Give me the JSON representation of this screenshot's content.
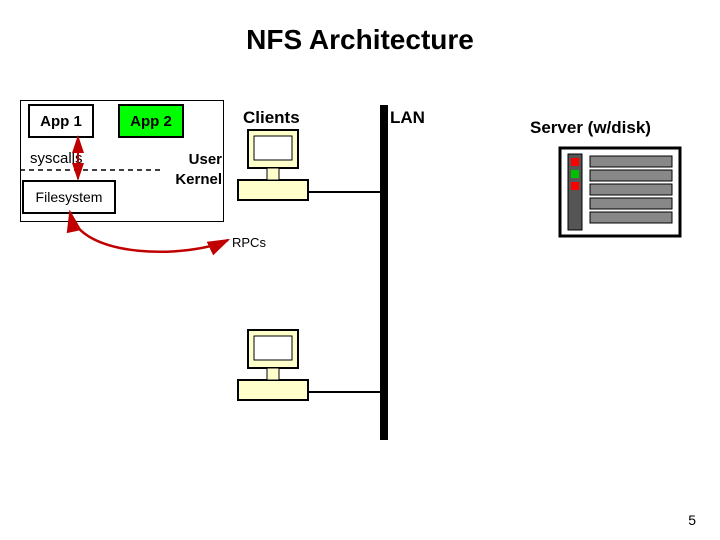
{
  "title": "NFS Architecture",
  "app1_label": "App 1",
  "app2_label": "App 2",
  "syscalls_label": "syscalls",
  "filesystem_label": "Filesystem",
  "user_label": "User",
  "kernel_label": "Kernel",
  "clients_label": "Clients",
  "lan_label": "LAN",
  "server_label": "Server (w/disk)",
  "rpcs_label": "RPCs",
  "page_number": "5",
  "colors": {
    "app2_fill": "#00ff00",
    "computer_fill": "#ffffcc",
    "led_green": "#00c000",
    "led_red": "#ff0000",
    "arrow_red": "#c00000"
  }
}
